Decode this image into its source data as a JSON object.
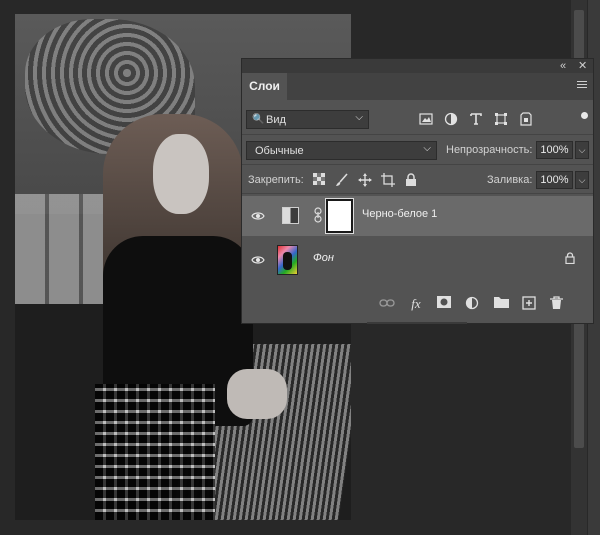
{
  "panel": {
    "collapse_label": "«",
    "close_label": "✕",
    "tab_label": "Слои",
    "filter": {
      "value": "Вид",
      "search_glyph": "🔍",
      "chevron": "⌵"
    },
    "blend_mode": "Обычные",
    "blend_chevron": "⌵",
    "opacity_label": "Непрозрачность:",
    "opacity_value": "100%",
    "lock_label": "Закрепить:",
    "fill_label": "Заливка:",
    "fill_value": "100%",
    "dropdown_glyph": "⌵",
    "layers": [
      {
        "name": "Черно-белое 1",
        "selected": true,
        "type": "adjustment"
      },
      {
        "name": "Фон",
        "selected": false,
        "type": "image",
        "locked": true
      }
    ],
    "filter_icons": [
      "image-filter-icon",
      "adjustment-filter-icon",
      "type-filter-icon",
      "shape-filter-icon",
      "smart-object-filter-icon"
    ],
    "bottom_icons": [
      "link-layers-icon",
      "fx-icon",
      "add-mask-icon",
      "new-adjustment-icon",
      "new-group-icon",
      "new-layer-icon",
      "delete-layer-icon"
    ],
    "fx_label": "fx"
  },
  "colors": {
    "panel_bg": "#535353",
    "selected_layer": "#6a6a6a",
    "workspace": "#282828"
  }
}
